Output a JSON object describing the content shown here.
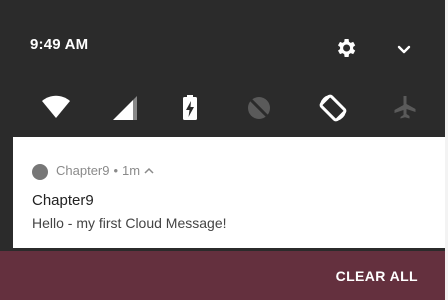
{
  "status_bar": {
    "time": "9:49 AM"
  },
  "quick_settings": {
    "icons": [
      "wifi-icon",
      "signal-icon",
      "battery-charging-icon",
      "do-not-disturb-icon",
      "auto-rotate-icon",
      "airplane-mode-icon"
    ]
  },
  "notification": {
    "app_name": "Chapter9",
    "separator": "•",
    "time_ago": "1m",
    "expand_glyph": "^",
    "title": "Chapter9",
    "body": "Hello - my first Cloud Message!"
  },
  "footer": {
    "clear_all_label": "CLEAR ALL"
  },
  "colors": {
    "shade": "#2b2b2b",
    "footer": "#64303e",
    "card": "#ffffff"
  }
}
